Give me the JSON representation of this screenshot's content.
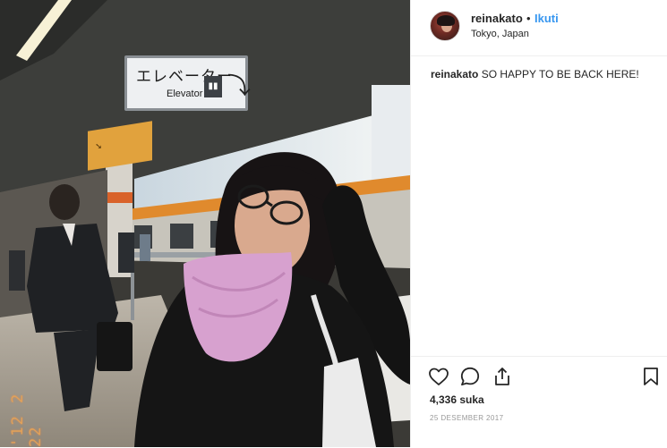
{
  "photo": {
    "alt_icon": "photo",
    "sign_elevator": {
      "jp": "エレベーター",
      "en": "Elevator"
    },
    "date_stamp": "'12 2 22"
  },
  "post": {
    "username": "reinakato",
    "separator": "•",
    "follow_label": "Ikuti",
    "location": "Tokyo, Japan",
    "caption_user": "reinakato",
    "caption_text": " SO HAPPY TO BE BACK HERE!",
    "likes": "4,336 suka",
    "date": "25 DESEMBER 2017"
  },
  "icons": {
    "like": "heart-icon",
    "comment": "comment-icon",
    "share": "share-icon",
    "save": "bookmark-icon"
  },
  "colors": {
    "link_blue": "#3897f0",
    "text": "#262626",
    "muted": "#999999",
    "border": "#efefef"
  }
}
